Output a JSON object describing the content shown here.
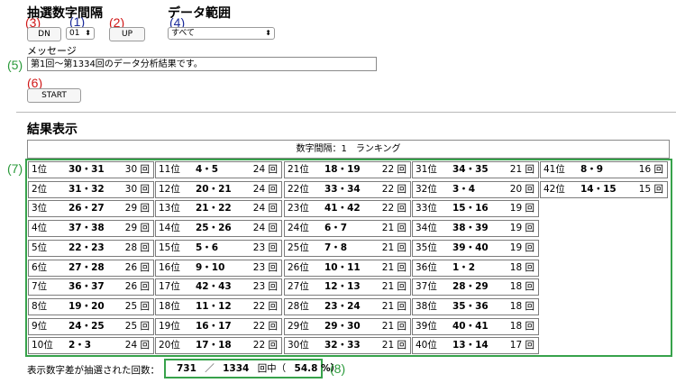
{
  "controls": {
    "interval_heading": "抽選数字間隔",
    "range_heading": "データ範囲",
    "dn_label": "DN",
    "interval_value": "01",
    "up_label": "UP",
    "range_value": "すべて",
    "message_label": "メッセージ",
    "message_text": "第1回〜第1334回のデータ分析結果です。",
    "start_label": "START"
  },
  "annotations": {
    "a1": "(1)",
    "a2": "(2)",
    "a3": "(3)",
    "a4": "(4)",
    "a5": "(5)",
    "a6": "(6)",
    "a7": "(7)",
    "a8": "(8)"
  },
  "results": {
    "heading": "結果表示",
    "ranking_title": "数字間隔：1　ランキング",
    "columns": [
      [
        {
          "rank": "1位",
          "pair": "30・31",
          "count": "30 回"
        },
        {
          "rank": "2位",
          "pair": "31・32",
          "count": "30 回"
        },
        {
          "rank": "3位",
          "pair": "26・27",
          "count": "29 回"
        },
        {
          "rank": "4位",
          "pair": "37・38",
          "count": "29 回"
        },
        {
          "rank": "5位",
          "pair": "22・23",
          "count": "28 回"
        },
        {
          "rank": "6位",
          "pair": "27・28",
          "count": "26 回"
        },
        {
          "rank": "7位",
          "pair": "36・37",
          "count": "26 回"
        },
        {
          "rank": "8位",
          "pair": "19・20",
          "count": "25 回"
        },
        {
          "rank": "9位",
          "pair": "24・25",
          "count": "25 回"
        },
        {
          "rank": "10位",
          "pair": "2・3",
          "count": "24 回"
        }
      ],
      [
        {
          "rank": "11位",
          "pair": "4・5",
          "count": "24 回"
        },
        {
          "rank": "12位",
          "pair": "20・21",
          "count": "24 回"
        },
        {
          "rank": "13位",
          "pair": "21・22",
          "count": "24 回"
        },
        {
          "rank": "14位",
          "pair": "25・26",
          "count": "24 回"
        },
        {
          "rank": "15位",
          "pair": "5・6",
          "count": "23 回"
        },
        {
          "rank": "16位",
          "pair": "9・10",
          "count": "23 回"
        },
        {
          "rank": "17位",
          "pair": "42・43",
          "count": "23 回"
        },
        {
          "rank": "18位",
          "pair": "11・12",
          "count": "22 回"
        },
        {
          "rank": "19位",
          "pair": "16・17",
          "count": "22 回"
        },
        {
          "rank": "20位",
          "pair": "17・18",
          "count": "22 回"
        }
      ],
      [
        {
          "rank": "21位",
          "pair": "18・19",
          "count": "22 回"
        },
        {
          "rank": "22位",
          "pair": "33・34",
          "count": "22 回"
        },
        {
          "rank": "23位",
          "pair": "41・42",
          "count": "22 回"
        },
        {
          "rank": "24位",
          "pair": "6・7",
          "count": "21 回"
        },
        {
          "rank": "25位",
          "pair": "7・8",
          "count": "21 回"
        },
        {
          "rank": "26位",
          "pair": "10・11",
          "count": "21 回"
        },
        {
          "rank": "27位",
          "pair": "12・13",
          "count": "21 回"
        },
        {
          "rank": "28位",
          "pair": "23・24",
          "count": "21 回"
        },
        {
          "rank": "29位",
          "pair": "29・30",
          "count": "21 回"
        },
        {
          "rank": "30位",
          "pair": "32・33",
          "count": "21 回"
        }
      ],
      [
        {
          "rank": "31位",
          "pair": "34・35",
          "count": "21 回"
        },
        {
          "rank": "32位",
          "pair": "3・4",
          "count": "20 回"
        },
        {
          "rank": "33位",
          "pair": "15・16",
          "count": "19 回"
        },
        {
          "rank": "34位",
          "pair": "38・39",
          "count": "19 回"
        },
        {
          "rank": "35位",
          "pair": "39・40",
          "count": "19 回"
        },
        {
          "rank": "36位",
          "pair": "1・2",
          "count": "18 回"
        },
        {
          "rank": "37位",
          "pair": "28・29",
          "count": "18 回"
        },
        {
          "rank": "38位",
          "pair": "35・36",
          "count": "18 回"
        },
        {
          "rank": "39位",
          "pair": "40・41",
          "count": "18 回"
        },
        {
          "rank": "40位",
          "pair": "13・14",
          "count": "17 回"
        }
      ],
      [
        {
          "rank": "41位",
          "pair": "8・9",
          "count": "16 回"
        },
        {
          "rank": "42位",
          "pair": "14・15",
          "count": "15 回"
        }
      ]
    ]
  },
  "footer": {
    "label": "表示数字差が抽選された回数：",
    "hits": "731",
    "sep": "／",
    "total": "1334",
    "unit": "回中（",
    "percent": "54.8 %）"
  }
}
